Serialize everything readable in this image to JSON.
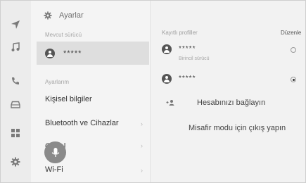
{
  "settings": {
    "title": "Ayarlar",
    "current_driver_label": "Mevcut sürücü",
    "current_driver_name": "*****",
    "my_settings_label": "Ayarlarım",
    "menu": [
      {
        "label": "Kişisel bilgiler"
      },
      {
        "label": "Bluetooth ve Cihazlar"
      },
      {
        "label": "Genel"
      },
      {
        "label": "Wi-Fi"
      }
    ]
  },
  "profiles": {
    "header": "Kayıtlı profiller",
    "edit_label": "Düzenle",
    "items": [
      {
        "name": "*****",
        "sub": "Birincil sürücü",
        "selected": false
      },
      {
        "name": "*****",
        "selected": true
      }
    ],
    "link_account": "Hesabınızı bağlayın",
    "guest_exit": "Misafir modu için çıkış yapın"
  },
  "rail_icons": [
    "navigation-icon",
    "music-icon",
    "phone-icon",
    "car-icon",
    "apps-icon",
    "settings-icon"
  ]
}
